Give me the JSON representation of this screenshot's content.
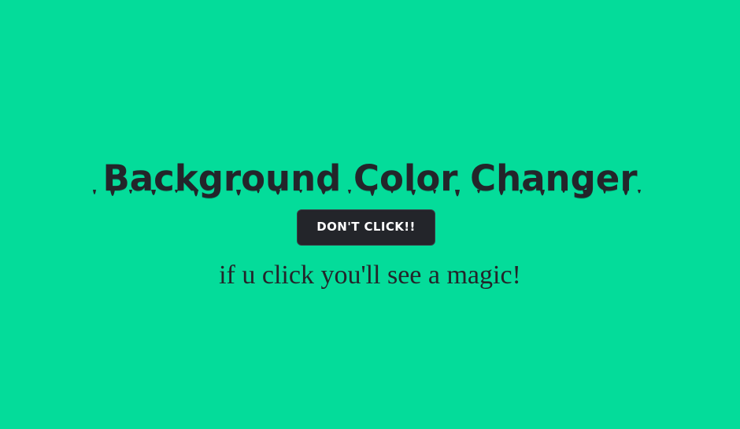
{
  "page": {
    "title": "Background Color Changer",
    "button_label": "DON'T CLICK!!",
    "subtitle": "if u click you'll see a magic!"
  },
  "colors": {
    "background": "#04dc9a",
    "text": "#23252a",
    "button_bg": "#23252a",
    "button_text": "#ffffff"
  }
}
